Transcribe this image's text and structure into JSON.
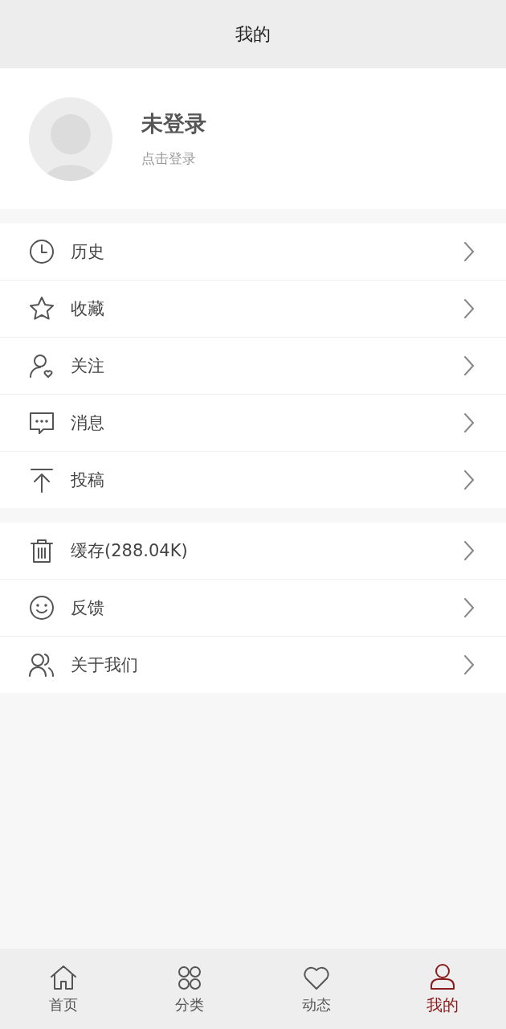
{
  "header": {
    "title": "我的"
  },
  "profile": {
    "name": "未登录",
    "hint": "点击登录"
  },
  "menu_groups": [
    [
      {
        "kind": "clock",
        "label": "历史"
      },
      {
        "kind": "star",
        "label": "收藏"
      },
      {
        "kind": "follow",
        "label": "关注"
      },
      {
        "kind": "message",
        "label": "消息"
      },
      {
        "kind": "upload",
        "label": "投稿"
      }
    ],
    [
      {
        "kind": "trash",
        "label": "缓存(288.04K)"
      },
      {
        "kind": "smile",
        "label": "反馈"
      },
      {
        "kind": "people",
        "label": "关于我们"
      }
    ]
  ],
  "tabs": [
    {
      "kind": "home",
      "label": "首页",
      "selected": false
    },
    {
      "kind": "grid",
      "label": "分类",
      "selected": false
    },
    {
      "kind": "heart",
      "label": "动态",
      "selected": false
    },
    {
      "kind": "person",
      "label": "我的",
      "selected": true
    }
  ]
}
